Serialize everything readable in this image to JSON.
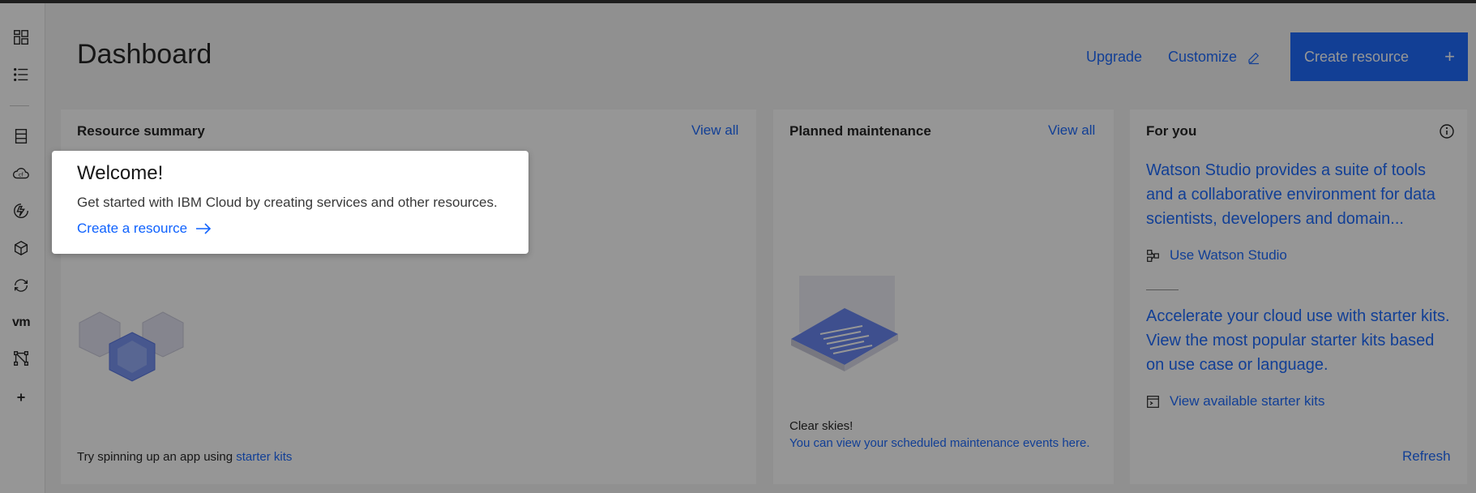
{
  "header": {
    "title": "Dashboard",
    "upgrade_label": "Upgrade",
    "customize_label": "Customize",
    "create_label": "Create resource",
    "create_icon": "plus-icon"
  },
  "sidebar": {
    "items": [
      {
        "icon": "dashboard-icon"
      },
      {
        "icon": "list-icon"
      },
      {
        "icon": "resource-list-icon"
      },
      {
        "icon": "cloud-foundry-icon"
      },
      {
        "icon": "functions-icon"
      },
      {
        "icon": "kubernetes-icon"
      },
      {
        "icon": "sync-icon"
      },
      {
        "label": "vm"
      },
      {
        "icon": "network-icon"
      },
      {
        "icon": "add-icon"
      }
    ]
  },
  "resource_summary": {
    "title": "Resource summary",
    "view_all": "View all",
    "footer_text": "Try spinning up an app using ",
    "footer_link": "starter kits"
  },
  "maintenance": {
    "title": "Planned maintenance",
    "view_all": "View all",
    "status": "Clear skies!",
    "link": "You can view your scheduled maintenance events here."
  },
  "for_you": {
    "title": "For you",
    "items": [
      {
        "text": "Watson Studio provides a suite of tools and a collaborative environment for data scientists, developers and domain...",
        "action": "Use Watson Studio"
      },
      {
        "text": "Accelerate your cloud use with starter kits. View the most popular starter kits based on use case or language.",
        "action": "View available starter kits"
      }
    ],
    "refresh": "Refresh"
  },
  "welcome_popup": {
    "title": "Welcome!",
    "body": "Get started with IBM Cloud by creating services and other resources.",
    "link": "Create a resource"
  },
  "colors": {
    "accent": "#0f62fe",
    "background": "#f4f4f4",
    "overlay": "rgba(22,22,22,0.45)"
  }
}
